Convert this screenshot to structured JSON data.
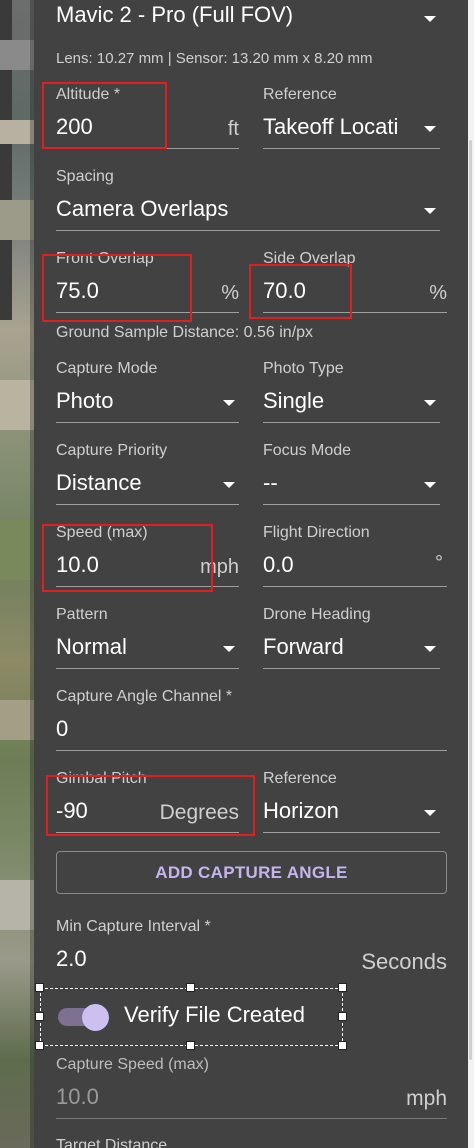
{
  "camera": {
    "model": "Mavic 2 - Pro (Full FOV)",
    "info": "Lens: 10.27 mm | Sensor: 13.20 mm x 8.20 mm"
  },
  "altitude": {
    "label": "Altitude *",
    "value": "200",
    "unit": "ft"
  },
  "altitude_reference": {
    "label": "Reference",
    "value": "Takeoff Locati"
  },
  "spacing": {
    "label": "Spacing",
    "value": "Camera Overlaps"
  },
  "front_overlap": {
    "label": "Front Overlap",
    "value": "75.0",
    "unit": "%"
  },
  "side_overlap": {
    "label": "Side Overlap",
    "value": "70.0",
    "unit": "%"
  },
  "gsd": {
    "text": "Ground Sample Distance: 0.56 in/px"
  },
  "capture_mode": {
    "label": "Capture Mode",
    "value": "Photo"
  },
  "photo_type": {
    "label": "Photo Type",
    "value": "Single"
  },
  "capture_priority": {
    "label": "Capture Priority",
    "value": "Distance"
  },
  "focus_mode": {
    "label": "Focus Mode",
    "value": "--"
  },
  "speed": {
    "label": "Speed (max)",
    "value": "10.0",
    "unit": "mph"
  },
  "flight_direction": {
    "label": "Flight Direction",
    "value": "0.0",
    "unit": "°"
  },
  "pattern": {
    "label": "Pattern",
    "value": "Normal"
  },
  "drone_heading": {
    "label": "Drone Heading",
    "value": "Forward"
  },
  "capture_angle_channel": {
    "label": "Capture Angle Channel *",
    "value": "0"
  },
  "gimbal_pitch": {
    "label": "Gimbal Pitch",
    "value": "-90",
    "unit": "Degrees"
  },
  "gimbal_reference": {
    "label": "Reference",
    "value": "Horizon"
  },
  "add_capture_angle": {
    "label": "ADD CAPTURE ANGLE"
  },
  "min_capture_interval": {
    "label": "Min Capture Interval *",
    "value": "2.0",
    "unit": "Seconds"
  },
  "verify_file": {
    "label": "Verify File Created",
    "checked": true
  },
  "capture_speed": {
    "label": "Capture Speed (max)",
    "value": "10.0",
    "unit": "mph"
  },
  "target_distance": {
    "label": "Target Distance"
  },
  "colors": {
    "panel": "#424242",
    "accent": "#c6b4ee",
    "highlight": "#e02020"
  }
}
